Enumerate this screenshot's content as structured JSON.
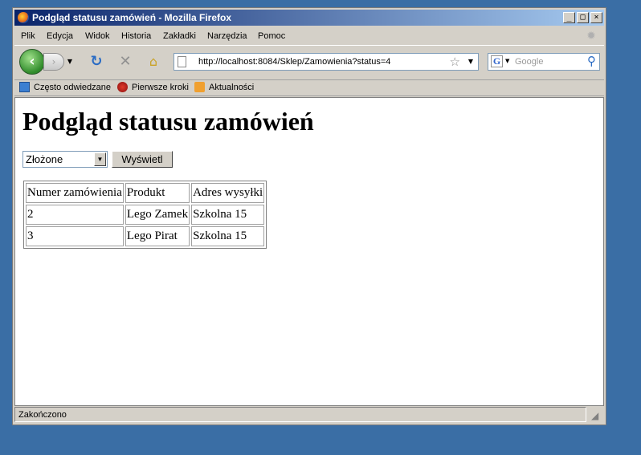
{
  "window": {
    "title": "Podgląd statusu zamówień - Mozilla Firefox",
    "minimize_glyph": "_",
    "maximize_glyph": "□",
    "close_glyph": "×"
  },
  "menu": {
    "items": [
      "Plik",
      "Edycja",
      "Widok",
      "Historia",
      "Zakładki",
      "Narzędzia",
      "Pomoc"
    ]
  },
  "nav": {
    "url": "http://localhost:8084/Sklep/Zamowienia?status=4",
    "search_placeholder": "Google",
    "search_engine_letter": "G"
  },
  "bookmarks": {
    "items": [
      "Często odwiedzane",
      "Pierwsze kroki",
      "Aktualności"
    ]
  },
  "page": {
    "heading": "Podgląd statusu zamówień",
    "status_select_value": "Złożone",
    "show_button_label": "Wyświetl",
    "table": {
      "headers": [
        "Numer zamówienia",
        "Produkt",
        "Adres wysyłki"
      ],
      "rows": [
        [
          "2",
          "Lego Zamek",
          "Szkolna 15"
        ],
        [
          "3",
          "Lego Pirat",
          "Szkolna 15"
        ]
      ]
    }
  },
  "status": {
    "text": "Zakończono"
  },
  "icons": {
    "back": "back-arrow-icon",
    "forward": "forward-arrow-icon",
    "reload": "reload-icon",
    "stop": "stop-icon",
    "home": "home-icon",
    "bookmark_star": "star-icon",
    "search": "magnifier-icon",
    "rss": "rss-icon"
  }
}
